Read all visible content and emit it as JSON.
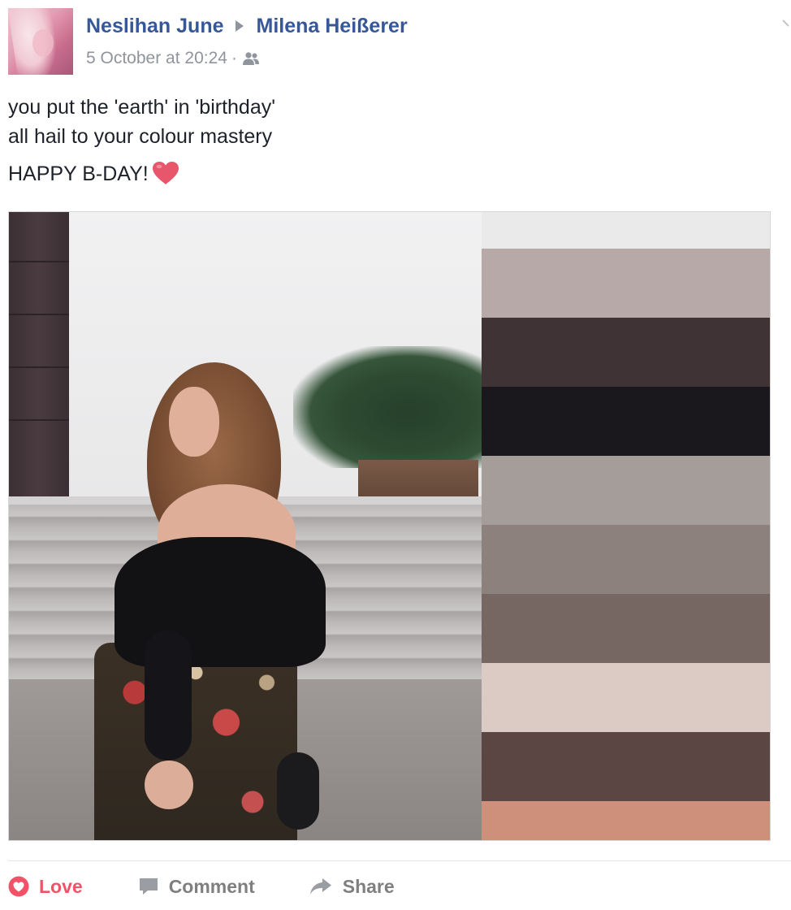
{
  "post": {
    "author": "Neslihan June",
    "target": "Milena Heißerer",
    "timestamp": "5 October at 20:24",
    "separator": "·",
    "audience_icon": "friends-icon"
  },
  "message": {
    "line1": "you put the 'earth' in 'birthday'",
    "line2": "all hail to your colour mastery",
    "line3": "HAPPY B-DAY!",
    "emoji": "heart-emoji"
  },
  "palette": {
    "colors": [
      "#b6a9a7",
      "#3f3335",
      "#1b181d",
      "#a49d9a",
      "#8d817d",
      "#766762",
      "#dccac5",
      "#5c4643",
      "#cf907b"
    ]
  },
  "actions": {
    "love_label": "Love",
    "comment_label": "Comment",
    "share_label": "Share"
  },
  "colors": {
    "link": "#365899",
    "meta": "#90949c",
    "love": "#f25268",
    "action": "#7f7f7f"
  }
}
